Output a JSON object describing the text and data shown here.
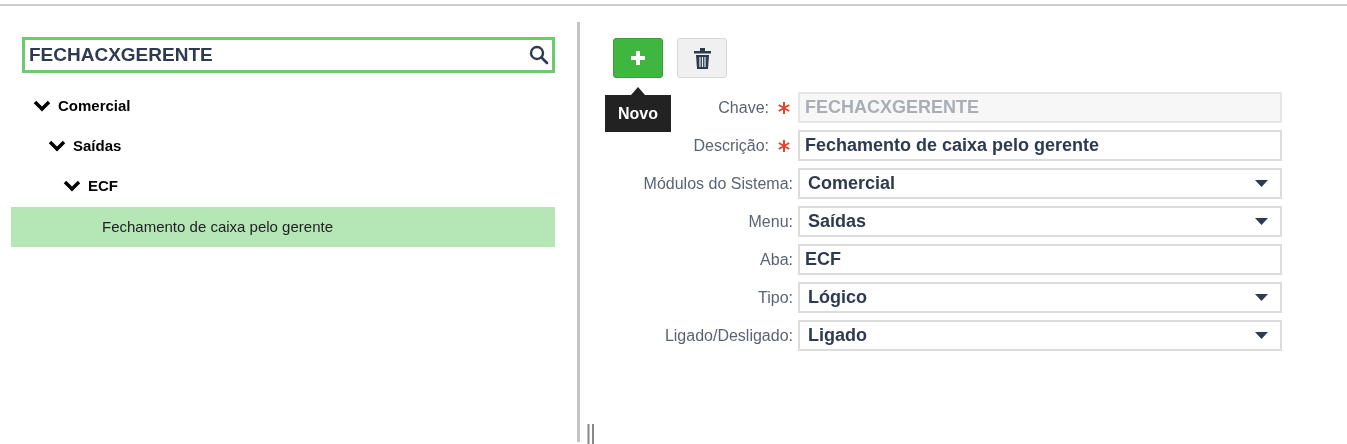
{
  "search": {
    "value": "FECHACXGERENTE"
  },
  "tree": [
    {
      "label": "Comercial",
      "expanded": true,
      "selected": false,
      "children": [
        {
          "label": "Saídas",
          "expanded": true,
          "selected": false,
          "children": [
            {
              "label": "ECF",
              "expanded": true,
              "selected": false,
              "children": [
                {
                  "label": "Fechamento de caixa pelo gerente",
                  "selected": true
                }
              ]
            }
          ]
        }
      ]
    }
  ],
  "toolbar": {
    "tooltip": "Novo"
  },
  "form": [
    {
      "label": "Chave:",
      "required": true,
      "kind": "text",
      "disabled": true,
      "value": "FECHACXGERENTE"
    },
    {
      "label": "Descrição:",
      "required": true,
      "kind": "text",
      "disabled": false,
      "value": "Fechamento de caixa pelo gerente"
    },
    {
      "label": "Módulos do Sistema:",
      "required": false,
      "kind": "select",
      "disabled": false,
      "value": "Comercial"
    },
    {
      "label": "Menu:",
      "required": false,
      "kind": "select",
      "disabled": false,
      "value": "Saídas"
    },
    {
      "label": "Aba:",
      "required": false,
      "kind": "text",
      "disabled": false,
      "value": "ECF"
    },
    {
      "label": "Tipo:",
      "required": false,
      "kind": "select",
      "disabled": false,
      "value": "Lógico"
    },
    {
      "label": "Ligado/Desligado:",
      "required": false,
      "kind": "select",
      "disabled": false,
      "value": "Ligado"
    }
  ]
}
